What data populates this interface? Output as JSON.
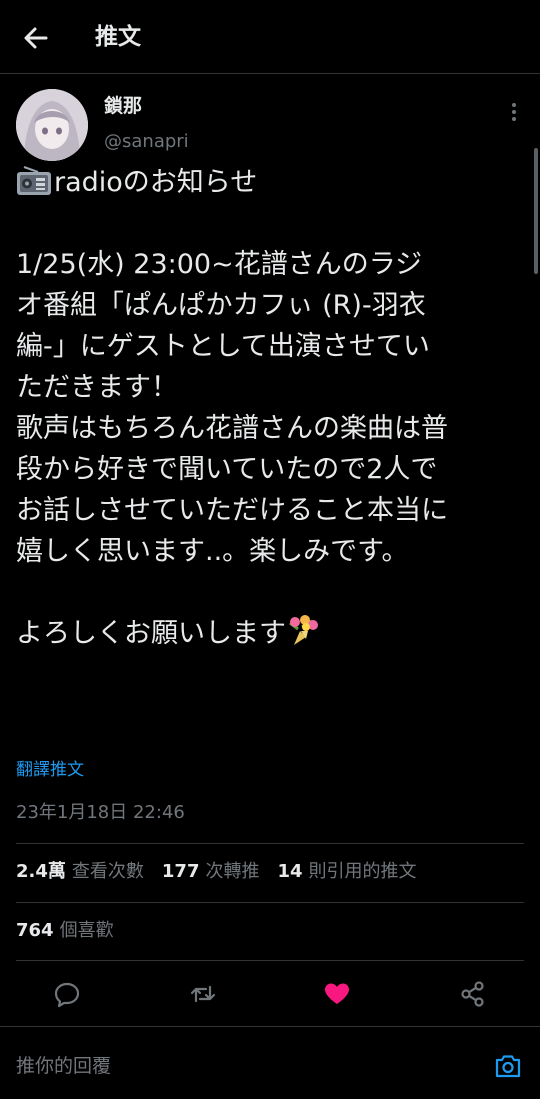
{
  "header": {
    "title": "推文",
    "back_icon": "back-arrow-icon"
  },
  "author": {
    "name": "鎖那",
    "handle": "@sanapri"
  },
  "tweet": {
    "lines": [
      "radioのお知らせ",
      "",
      "1/25(水) 23:00~花譜さんのラジ",
      "オ番組「ぱんぱかカフぃ (R)-羽衣",
      "編-」にゲストとして出演させてい",
      "ただきます！",
      "歌声はもちろん花譜さんの楽曲は普",
      "段から好きで聞いていたので2人で",
      "お話しさせていただけること本当に",
      "嬉しく思います..。楽しみです。",
      "",
      "よろしくお願いします"
    ],
    "translate_label": "翻譯推文",
    "timestamp": "23年1月18日 22:46"
  },
  "stats": {
    "views_num": "2.4萬",
    "views_label": "查看次數",
    "retweets_num": "177",
    "retweets_label": "次轉推",
    "quotes_num": "14",
    "quotes_label": "則引用的推文",
    "likes_num": "764",
    "likes_label": "個喜歡"
  },
  "reply": {
    "placeholder": "推你的回覆"
  },
  "colors": {
    "accent": "#1d9bf0",
    "like": "#f91880",
    "muted": "#71767b",
    "text": "#e7e9ea",
    "divider": "#2f3336"
  }
}
